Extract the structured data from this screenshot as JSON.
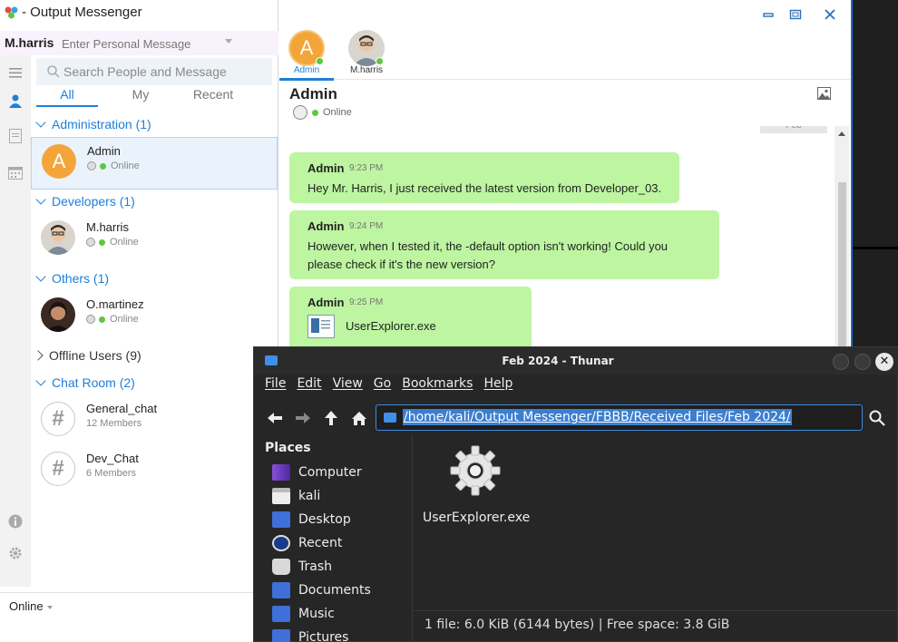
{
  "messenger": {
    "app_title": "- Output Messenger",
    "username": "M.harris",
    "personal_message_placeholder": "Enter Personal Message",
    "search_placeholder": "Search People and Message",
    "tabs": [
      "All",
      "My",
      "Recent"
    ],
    "groups": [
      {
        "label": "Administration (1)",
        "contacts": [
          {
            "name": "Admin",
            "status": "Online",
            "avatar_letter": "A"
          }
        ]
      },
      {
        "label": "Developers (1)",
        "contacts": [
          {
            "name": "M.harris",
            "status": "Online"
          }
        ]
      },
      {
        "label": "Others (1)",
        "contacts": [
          {
            "name": "O.martinez",
            "status": "Online"
          }
        ]
      }
    ],
    "offline_label": "Offline Users (9)",
    "chat_room_label": "Chat Room (2)",
    "chat_rooms": [
      {
        "name": "General_chat",
        "members": "12 Members"
      },
      {
        "name": "Dev_Chat",
        "members": "6 Members"
      }
    ],
    "my_status": "Online",
    "chat_tabs": [
      {
        "label": "Admin",
        "avatar_letter": "A"
      },
      {
        "label": "M.harris"
      }
    ],
    "chat_header": {
      "name": "Admin",
      "status": "Online"
    },
    "date_chip": "Feb",
    "messages": [
      {
        "sender": "Admin",
        "time": "9:23 PM",
        "lines": [
          "Hey Mr. Harris, I just received the latest version from Developer_03."
        ]
      },
      {
        "sender": "Admin",
        "time": "9:24 PM",
        "lines": [
          "However, when I tested it, the -default option isn't working! Could you",
          "please check if it's the new version?"
        ]
      },
      {
        "sender": "Admin",
        "time": "9:25 PM",
        "file": "UserExplorer.exe"
      }
    ]
  },
  "thunar": {
    "title": "Feb 2024 - Thunar",
    "menu": [
      "File",
      "Edit",
      "View",
      "Go",
      "Bookmarks",
      "Help"
    ],
    "path": "/home/kali/Output Messenger/FBBB/Received Files/Feb 2024/",
    "places_heading": "Places",
    "places": [
      "Computer",
      "kali",
      "Desktop",
      "Recent",
      "Trash",
      "Documents",
      "Music",
      "Pictures"
    ],
    "file_name": "UserExplorer.exe",
    "status": "1 file: 6.0 KiB (6144 bytes) | Free space: 3.8 GiB"
  },
  "colors": {
    "accent": "#1e7fd8",
    "bubble": "#bdf5a1",
    "online": "#5fc640",
    "avatar_admin": "#f4a53a"
  }
}
